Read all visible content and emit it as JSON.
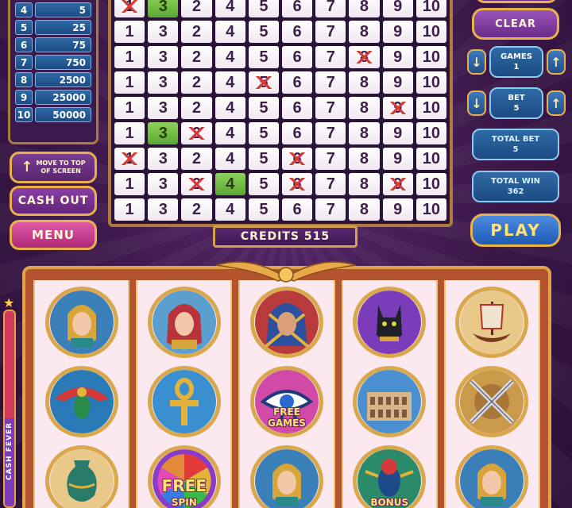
{
  "paytable": [
    {
      "hits": "4",
      "pays": "5"
    },
    {
      "hits": "5",
      "pays": "25"
    },
    {
      "hits": "6",
      "pays": "75"
    },
    {
      "hits": "7",
      "pays": "750"
    },
    {
      "hits": "8",
      "pays": "2500"
    },
    {
      "hits": "9",
      "pays": "25000"
    },
    {
      "hits": "10",
      "pays": "50000"
    }
  ],
  "left_buttons": {
    "move_line1": "MOVE TO TOP",
    "move_line2": "OF SCREEN",
    "cash_out": "CASH OUT",
    "menu": "MENU"
  },
  "board": {
    "columns": [
      "1",
      "3",
      "2",
      "4",
      "5",
      "6",
      "7",
      "8",
      "9",
      "10"
    ],
    "rows": [
      {
        "hit": [
          1
        ],
        "picked": [
          0
        ]
      },
      {
        "hit": [],
        "picked": []
      },
      {
        "hit": [],
        "picked": [
          7
        ]
      },
      {
        "hit": [],
        "picked": [
          4
        ]
      },
      {
        "hit": [],
        "picked": [
          8
        ]
      },
      {
        "hit": [
          1
        ],
        "picked": [
          2
        ]
      },
      {
        "hit": [],
        "picked": [
          0,
          5
        ]
      },
      {
        "hit": [
          3
        ],
        "picked": [
          2,
          5,
          8
        ]
      },
      {
        "hit": [],
        "picked": []
      }
    ]
  },
  "credits": "CREDITS 515",
  "right": {
    "clear": "CLEAR",
    "games_label": "GAMES",
    "games_value": "1",
    "bet_label": "BET",
    "bet_value": "5",
    "total_bet_label": "TOTAL BET",
    "total_bet_value": "5",
    "total_win_label": "TOTAL WIN",
    "total_win_value": "362",
    "play": "PLAY"
  },
  "reels": [
    [
      {
        "symbol": "queen-gold"
      },
      {
        "symbol": "scarab-bird"
      },
      {
        "symbol": "amphora"
      }
    ],
    [
      {
        "symbol": "queen-red"
      },
      {
        "symbol": "ankh"
      },
      {
        "symbol": "free-spin",
        "label": "FREE",
        "sub": "SPIN"
      }
    ],
    [
      {
        "symbol": "pharaoh"
      },
      {
        "symbol": "eye-of-horus",
        "label": "FREE GAMES"
      },
      {
        "symbol": "queen-gold"
      }
    ],
    [
      {
        "symbol": "cat"
      },
      {
        "symbol": "colosseum"
      },
      {
        "symbol": "scarab-bonus",
        "label": "BONUS"
      }
    ],
    [
      {
        "symbol": "ship"
      },
      {
        "symbol": "swords"
      },
      {
        "symbol": "queen-gold"
      }
    ]
  ],
  "fever": {
    "label": "CASH FEVER",
    "level": 0.45
  },
  "colors": {
    "hit": "#6cbf3a",
    "pick_mark": "#d63a3a",
    "gold": "#e1a24a"
  }
}
